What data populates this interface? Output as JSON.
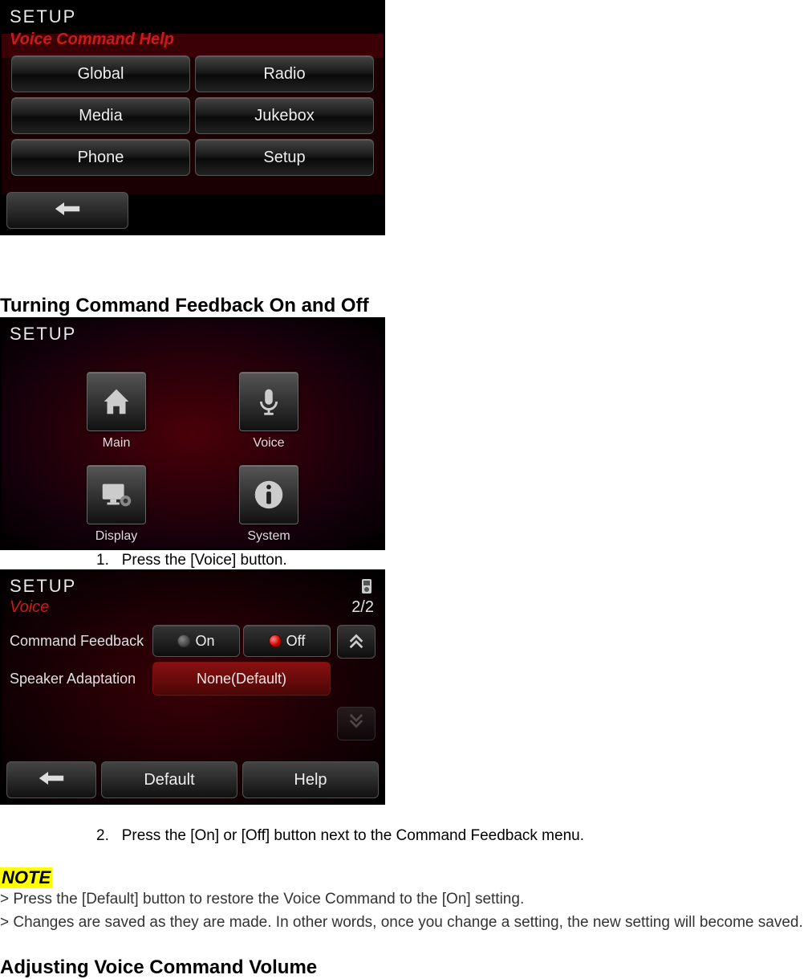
{
  "screenshot1": {
    "title": "SETUP",
    "subtitle": "Voice Command Help",
    "buttons": [
      "Global",
      "Radio",
      "Media",
      "Jukebox",
      "Phone",
      "Setup"
    ]
  },
  "heading_feedback": "Turning Command Feedback On and Off",
  "screenshot2": {
    "title": "SETUP",
    "items": [
      {
        "label": "Main",
        "icon": "home-icon"
      },
      {
        "label": "Voice",
        "icon": "mic-icon"
      },
      {
        "label": "Display",
        "icon": "monitor-gear-icon"
      },
      {
        "label": "System",
        "icon": "info-icon"
      }
    ]
  },
  "step1": {
    "num": "1.",
    "text": "Press the [Voice] button."
  },
  "screenshot3": {
    "title": "SETUP",
    "subtitle": "Voice",
    "page_indicator": "2/2",
    "rows": {
      "command_feedback": {
        "label": "Command Feedback",
        "options": [
          "On",
          "Off"
        ],
        "selected": "Off"
      },
      "speaker_adaptation": {
        "label": "Speaker Adaptation",
        "value": "None(Default)"
      }
    },
    "bottom_buttons": {
      "default": "Default",
      "help": "Help"
    }
  },
  "step2": {
    "num": "2.",
    "text": "Press the [On] or [Off] button next to the Command Feedback menu."
  },
  "note": {
    "label": "NOTE",
    "line1": "> Press the [Default] button to restore the Voice Command to the [On] setting.",
    "line2": "> Changes are saved as they are made. In other words, once you change a setting, the new setting will become saved."
  },
  "heading_volume": "Adjusting Voice Command Volume"
}
